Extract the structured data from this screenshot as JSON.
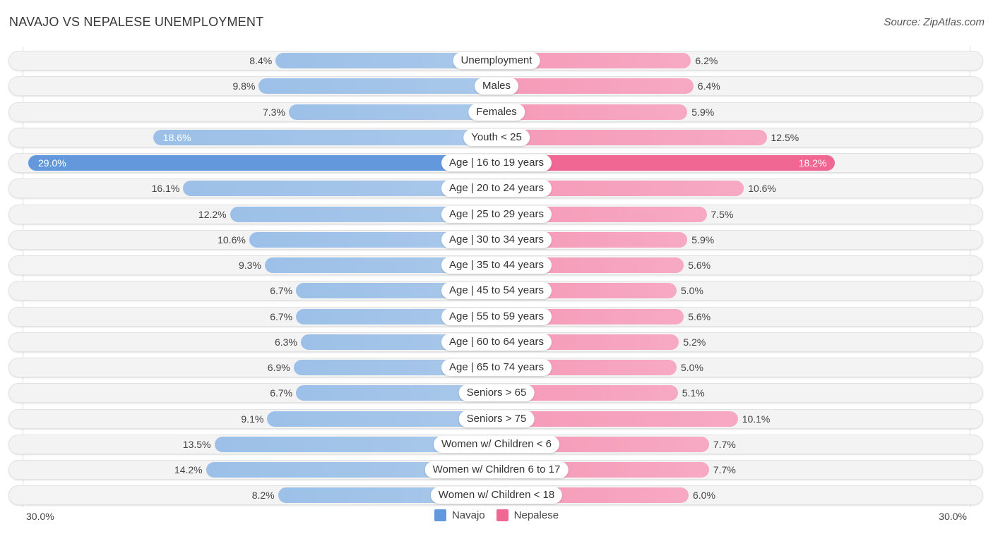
{
  "header": {
    "title": "NAVAJO VS NEPALESE UNEMPLOYMENT",
    "source": "Source: ZipAtlas.com"
  },
  "colors": {
    "navajo": "#6399dc",
    "nepalese": "#f06794"
  },
  "chart_data": {
    "type": "bar",
    "orientation": "horizontal-diverging",
    "title": "NAVAJO VS NEPALESE UNEMPLOYMENT",
    "xlabel": "",
    "ylabel": "",
    "xlim": [
      0,
      30.0
    ],
    "axis_labels": {
      "left": "30.0%",
      "right": "30.0%"
    },
    "legend": {
      "placement": "bottom-center",
      "entries": [
        "Navajo",
        "Nepalese"
      ]
    },
    "categories": [
      "Unemployment",
      "Males",
      "Females",
      "Youth < 25",
      "Age | 16 to 19 years",
      "Age | 20 to 24 years",
      "Age | 25 to 29 years",
      "Age | 30 to 34 years",
      "Age | 35 to 44 years",
      "Age | 45 to 54 years",
      "Age | 55 to 59 years",
      "Age | 60 to 64 years",
      "Age | 65 to 74 years",
      "Seniors > 65",
      "Seniors > 75",
      "Women w/ Children < 6",
      "Women w/ Children 6 to 17",
      "Women w/ Children < 18"
    ],
    "series": [
      {
        "name": "Navajo",
        "unit": "%",
        "values": [
          8.4,
          9.8,
          7.3,
          18.6,
          29.0,
          16.1,
          12.2,
          10.6,
          9.3,
          6.7,
          6.7,
          6.3,
          6.9,
          6.7,
          9.1,
          13.5,
          14.2,
          8.2
        ],
        "labels": [
          "8.4%",
          "9.8%",
          "7.3%",
          "18.6%",
          "29.0%",
          "16.1%",
          "12.2%",
          "10.6%",
          "9.3%",
          "6.7%",
          "6.7%",
          "6.3%",
          "6.9%",
          "6.7%",
          "9.1%",
          "13.5%",
          "14.2%",
          "8.2%"
        ]
      },
      {
        "name": "Nepalese",
        "unit": "%",
        "values": [
          6.2,
          6.4,
          5.9,
          12.5,
          18.2,
          10.6,
          7.5,
          5.9,
          5.6,
          5.0,
          5.6,
          5.2,
          5.0,
          5.1,
          10.1,
          7.7,
          7.7,
          6.0
        ],
        "labels": [
          "6.2%",
          "6.4%",
          "5.9%",
          "12.5%",
          "18.2%",
          "10.6%",
          "7.5%",
          "5.9%",
          "5.6%",
          "5.0%",
          "5.6%",
          "5.2%",
          "5.0%",
          "5.1%",
          "10.1%",
          "7.7%",
          "7.7%",
          "6.0%"
        ]
      }
    ],
    "highlighted_category": "Age | 16 to 19 years",
    "grid": false
  }
}
